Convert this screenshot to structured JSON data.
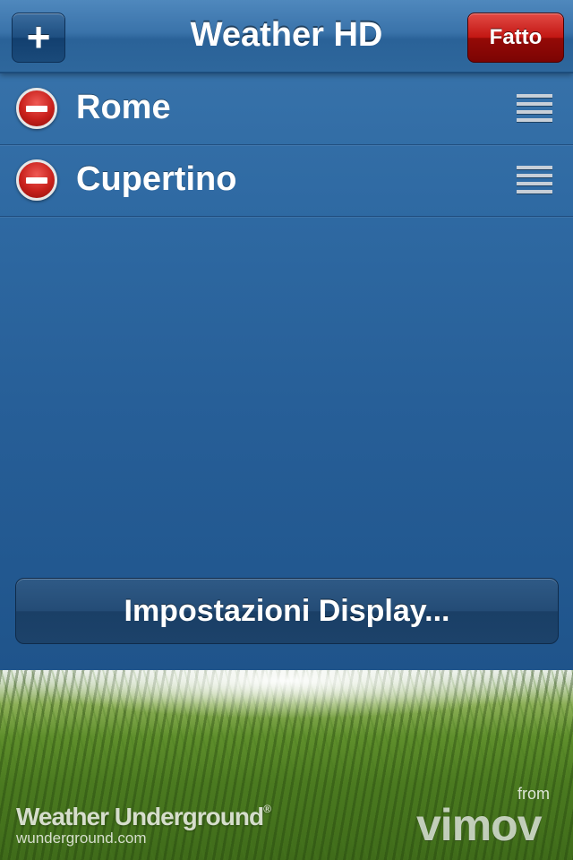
{
  "header": {
    "title": "Weather HD",
    "add_label": "+",
    "done_label": "Fatto"
  },
  "cities": [
    {
      "name": "Rome"
    },
    {
      "name": "Cupertino"
    }
  ],
  "settings_button_label": "Impostazioni Display...",
  "footer": {
    "weather_underground_name": "Weather Underground",
    "weather_underground_reg": "®",
    "weather_underground_url": "wunderground.com",
    "from_label": "from",
    "vimov_label": "vimov"
  },
  "icons": {
    "delete": "delete-circle-icon",
    "reorder": "reorder-grip-icon"
  },
  "colors": {
    "panel_blue": "#2f6aa3",
    "done_red": "#c21612"
  }
}
